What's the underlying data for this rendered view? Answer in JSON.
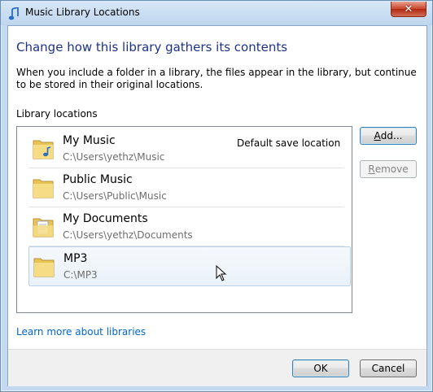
{
  "window": {
    "title": "Music Library Locations",
    "close_glyph": "✕"
  },
  "main": {
    "heading": "Change how this library gathers its contents",
    "description": "When you include a folder in a library, the files appear in the library, but continue to be stored in their original locations.",
    "locations_label": "Library locations"
  },
  "locations": [
    {
      "name": "My Music",
      "path": "C:\\Users\\yethz\\Music",
      "tag": "Default save location",
      "icon": "music-folder-icon"
    },
    {
      "name": "Public Music",
      "path": "C:\\Users\\Public\\Music",
      "tag": "",
      "icon": "folder-icon"
    },
    {
      "name": "My Documents",
      "path": "C:\\Users\\yethz\\Documents",
      "tag": "",
      "icon": "documents-folder-icon"
    },
    {
      "name": "MP3",
      "path": "C:\\MP3",
      "tag": "",
      "icon": "folder-icon",
      "selected": true
    }
  ],
  "buttons": {
    "add": "Add...",
    "remove": "Remove",
    "ok": "OK",
    "cancel": "Cancel"
  },
  "link": {
    "learn_more": "Learn more about libraries"
  },
  "colors": {
    "heading": "#1e3287",
    "link": "#0066cc",
    "selection": "#e9f1f9"
  }
}
